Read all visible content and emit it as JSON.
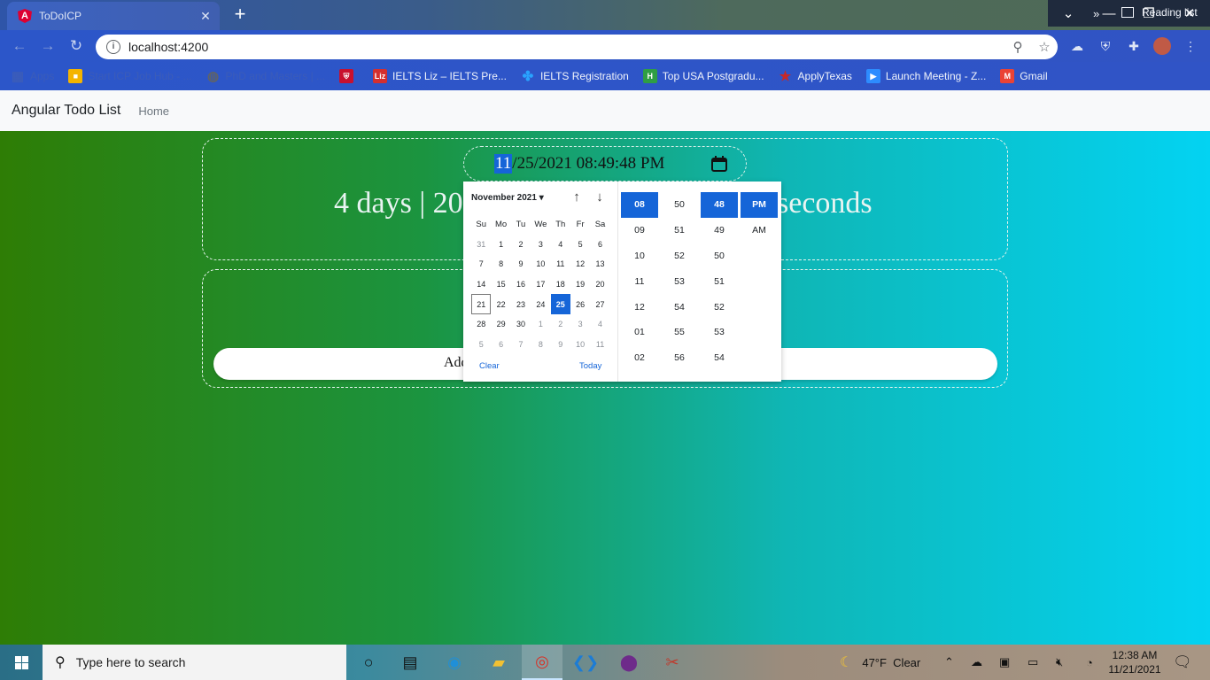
{
  "browser": {
    "tab_title": "ToDoICP",
    "url": "localhost:4200",
    "bookmarks": [
      {
        "label": "Apps",
        "color": "#3b5cb9",
        "icon": "apps-grid-icon",
        "faded": true
      },
      {
        "label": "Start ICP Job Hub - ...",
        "color": "#f4b400",
        "icon": "colorful-grid-icon",
        "faded": true
      },
      {
        "label": "PhD and Masters | ...",
        "color": "#5f6368",
        "icon": "globe-icon",
        "faded": true
      },
      {
        "label": "",
        "color": "#c8102e",
        "icon": "shield-crest-icon",
        "faded": false
      },
      {
        "label": "IELTS Liz – IELTS Pre...",
        "color": "#d32f2f",
        "icon": "liz-logo-icon",
        "faded": false
      },
      {
        "label": "IELTS Registration",
        "color": "#29a3ff",
        "icon": "clover-icon",
        "faded": false
      },
      {
        "label": "Top USA Postgradu...",
        "color": "#2f9e44",
        "icon": "h-logo-icon",
        "faded": false
      },
      {
        "label": "ApplyTexas",
        "color": "#c62828",
        "icon": "star-icon",
        "faded": false
      },
      {
        "label": "Launch Meeting - Z...",
        "color": "#2d8cff",
        "icon": "zoom-icon",
        "faded": false
      },
      {
        "label": "Gmail",
        "color": "#ea4335",
        "icon": "gmail-icon",
        "faded": false
      }
    ],
    "more": "»",
    "reading_list": "Reading list"
  },
  "app": {
    "brand": "Angular Todo List",
    "nav_home": "Home",
    "datetime_month": "11",
    "datetime_rest": "/25/2021 08:49:48 PM",
    "countdown_left": "4 days | 20",
    "countdown_right": "seconds",
    "add_label_partial": "Add"
  },
  "picker": {
    "month_label": "November 2021",
    "weekdays": [
      "Su",
      "Mo",
      "Tu",
      "We",
      "Th",
      "Fr",
      "Sa"
    ],
    "weeks": [
      [
        "31",
        "1",
        "2",
        "3",
        "4",
        "5",
        "6"
      ],
      [
        "7",
        "8",
        "9",
        "10",
        "11",
        "12",
        "13"
      ],
      [
        "14",
        "15",
        "16",
        "17",
        "18",
        "19",
        "20"
      ],
      [
        "21",
        "22",
        "23",
        "24",
        "25",
        "26",
        "27"
      ],
      [
        "28",
        "29",
        "30",
        "1",
        "2",
        "3",
        "4"
      ],
      [
        "5",
        "6",
        "7",
        "8",
        "9",
        "10",
        "11"
      ]
    ],
    "selected_day": "25",
    "today_day": "21",
    "clear_label": "Clear",
    "today_label": "Today",
    "hours": [
      "08",
      "09",
      "10",
      "11",
      "12",
      "01",
      "02"
    ],
    "minutes": [
      "50",
      "51",
      "52",
      "53",
      "54",
      "55",
      "56"
    ],
    "seconds": [
      "48",
      "49",
      "50",
      "51",
      "52",
      "53",
      "54"
    ],
    "ampm": [
      "PM",
      "AM"
    ],
    "active_hour": "08",
    "active_second": "48",
    "active_ampm": "PM"
  },
  "taskbar": {
    "search_placeholder": "Type here to search",
    "weather": "47°F  Clear",
    "time": "12:38 AM",
    "date": "11/21/2021"
  }
}
